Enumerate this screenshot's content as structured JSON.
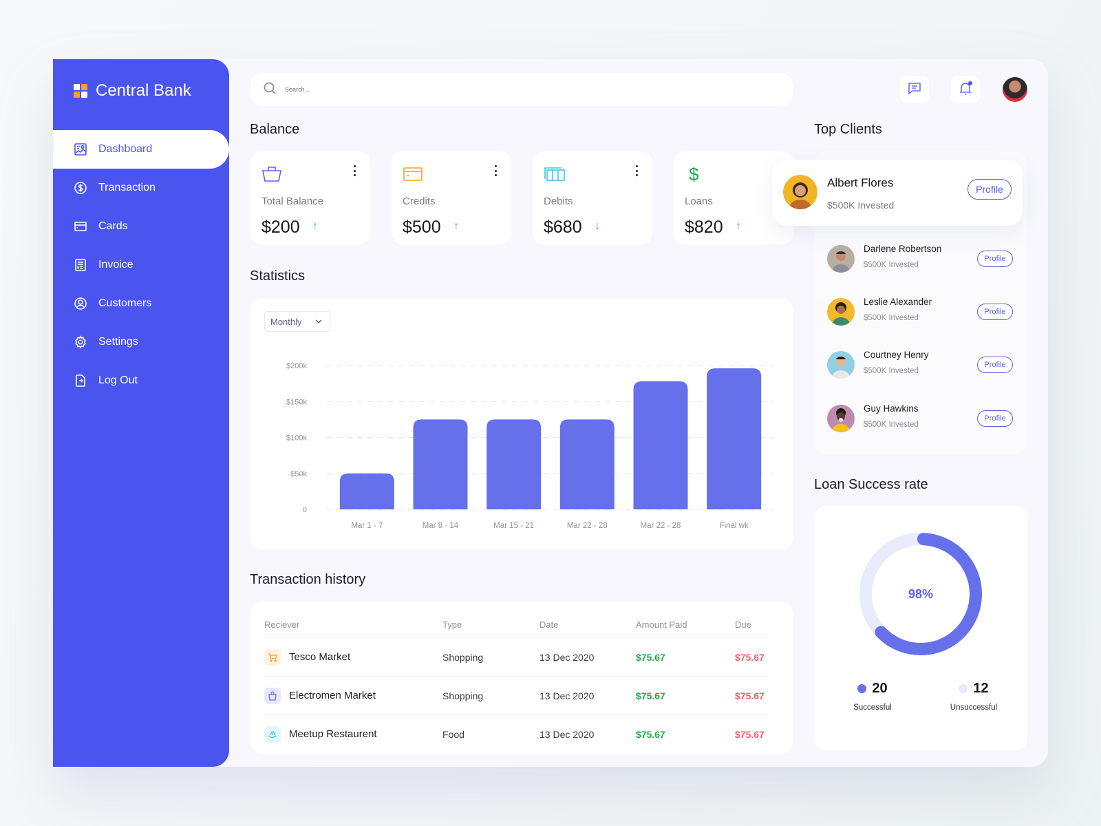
{
  "brand": {
    "name": "Central Bank",
    "logo_colors": [
      "#ffffff",
      "#f7a02c",
      "#f7a02c",
      "#ffffff"
    ]
  },
  "colors": {
    "primary": "#4a55f0",
    "bar": "#6570ea",
    "success": "#22a84a",
    "danger": "#f0606a",
    "donut_track": "#e9eafb"
  },
  "sidebar": {
    "items": [
      {
        "label": "Dashboard",
        "icon": "dashboard-icon",
        "active": true
      },
      {
        "label": "Transaction",
        "icon": "dollar-circle-icon",
        "active": false
      },
      {
        "label": "Cards",
        "icon": "card-icon",
        "active": false
      },
      {
        "label": "Invoice",
        "icon": "invoice-icon",
        "active": false
      },
      {
        "label": "Customers",
        "icon": "user-circle-icon",
        "active": false
      },
      {
        "label": "Settings",
        "icon": "gear-icon",
        "active": false
      },
      {
        "label": "Log Out",
        "icon": "logout-icon",
        "active": false
      }
    ]
  },
  "header": {
    "search_placeholder": "Search...",
    "icons": [
      "message-icon",
      "bell-icon",
      "avatar"
    ],
    "notification_dot": true
  },
  "balance": {
    "title": "Balance",
    "cards": [
      {
        "label": "Total Balance",
        "value": "$200",
        "trend": "up",
        "icon": "basket-icon",
        "icon_color": "#5b62e8"
      },
      {
        "label": "Credits",
        "value": "$500",
        "trend": "up",
        "icon": "credit-card-icon",
        "icon_color": "#f7a02c"
      },
      {
        "label": "Debits",
        "value": "$680",
        "trend": "down",
        "icon": "columns-icon",
        "icon_color": "#3fc4ef"
      },
      {
        "label": "Loans",
        "value": "$820",
        "trend": "up",
        "icon": "dollar-icon",
        "icon_color": "#22a84a"
      }
    ]
  },
  "statistics": {
    "title": "Statistics",
    "period_selected": "Monthly"
  },
  "chart_data": {
    "type": "bar",
    "title": "Statistics",
    "categories": [
      "Mar 1 - 7",
      "Mar 8 - 14",
      "Mar 15 - 21",
      "Mar 22 - 28",
      "Mar 22 - 28",
      "Final wk"
    ],
    "values": [
      50000,
      125000,
      125000,
      125000,
      178000,
      196000
    ],
    "yticks": [
      0,
      50000,
      100000,
      150000,
      200000
    ],
    "ytick_labels": [
      "0",
      "$50k",
      "$100k",
      "$150k",
      "$200k"
    ],
    "ylim": [
      0,
      200000
    ],
    "xlabel": "",
    "ylabel": "",
    "grid": true
  },
  "transactions": {
    "title": "Transaction history",
    "columns": [
      "Reciever",
      "Type",
      "Date",
      "Amount Paid",
      "Due"
    ],
    "rows": [
      {
        "receiver": "Tesco Market",
        "icon": "cart-icon",
        "type": "Shopping",
        "date": "13 Dec 2020",
        "paid": "$75.67",
        "due": "$75.67"
      },
      {
        "receiver": "Electromen Market",
        "icon": "bag-icon",
        "type": "Shopping",
        "date": "13 Dec 2020",
        "paid": "$75.67",
        "due": "$75.67"
      },
      {
        "receiver": "Meetup Restaurent",
        "icon": "food-icon",
        "type": "Food",
        "date": "13 Dec 2020",
        "paid": "$75.67",
        "due": "$75.67"
      }
    ]
  },
  "top_clients": {
    "title": "Top Clients",
    "profile_label": "Profile",
    "featured": {
      "name": "Albert Flores",
      "sub": "$500K Invested"
    },
    "list": [
      {
        "name": "Darlene Robertson",
        "sub": "$500K Invested"
      },
      {
        "name": "Leslie Alexander",
        "sub": "$500K Invested"
      },
      {
        "name": "Courtney Henry",
        "sub": "$500K Invested"
      },
      {
        "name": "Guy Hawkins",
        "sub": "$500K Invested"
      }
    ]
  },
  "loan_success": {
    "title": "Loan Success rate",
    "percent_label": "98%",
    "arc_fraction": 0.62,
    "successful": {
      "value": "20",
      "label": "Successful"
    },
    "unsuccessful": {
      "value": "12",
      "label": "Unsuccessful"
    }
  }
}
